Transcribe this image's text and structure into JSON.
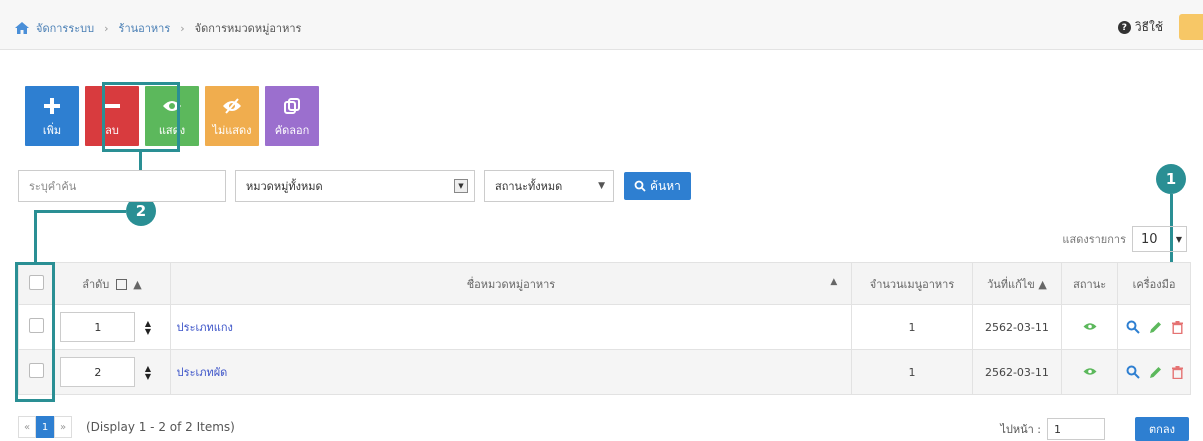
{
  "breadcrumb": {
    "items": [
      "จัดการระบบ",
      "ร้านอาหาร"
    ],
    "current": "จัดการหมวดหมู่อาหาร"
  },
  "help": {
    "label": "วิธีใช้"
  },
  "toolbar": {
    "add": "เพิ่ม",
    "delete": "ลบ",
    "show": "แสดง",
    "hide": "ไม่แสดง",
    "copy": "คัดลอก"
  },
  "filters": {
    "keyword_placeholder": "ระบุคำค้น",
    "category": "หมวดหมู่ทั้งหมด",
    "status": "สถานะทั้งหมด",
    "search": "ค้นหา"
  },
  "perpage": {
    "label": "แสดงรายการ",
    "value": "10"
  },
  "table": {
    "headers": {
      "order": "ลำดับ",
      "name": "ชื่อหมวดหมู่อาหาร",
      "count": "จำนวนเมนูอาหาร",
      "date": "วันที่แก้ไข",
      "status": "สถานะ",
      "tools": "เครื่องมือ"
    },
    "rows": [
      {
        "order": "1",
        "name": "ประเภทแกง",
        "count": "1",
        "date": "2562-03-11"
      },
      {
        "order": "2",
        "name": "ประเภทผัด",
        "count": "1",
        "date": "2562-03-11"
      }
    ]
  },
  "pager": {
    "prev": "«",
    "page": "1",
    "next": "»",
    "info": "(Display 1 - 2 of 2 Items)"
  },
  "goto": {
    "label": "ไปหน้า :",
    "value": "1",
    "button": "ตกลง"
  },
  "callouts": {
    "one": "1",
    "two": "2"
  },
  "colors": {
    "accent": "#2a8f94",
    "primary": "#2e7fd1",
    "danger": "#d83b3e",
    "success": "#5cb85c",
    "warning": "#f0ad4e",
    "purple": "#9b6fce"
  }
}
